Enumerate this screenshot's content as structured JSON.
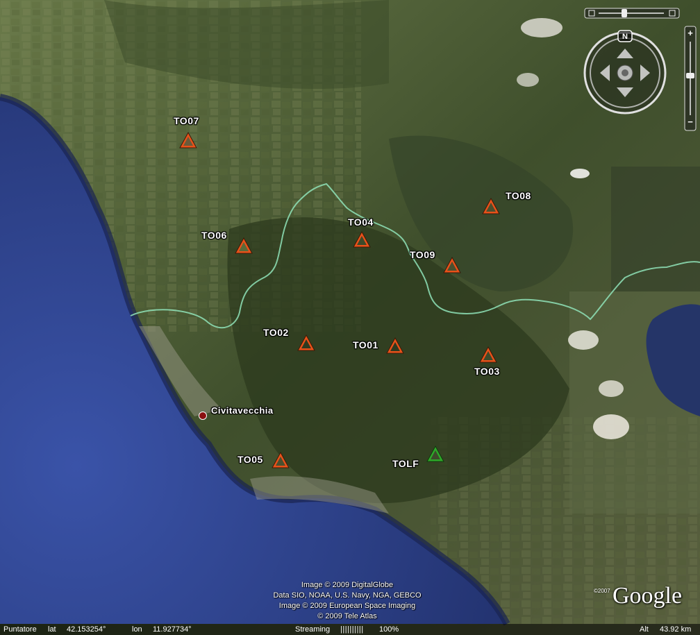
{
  "stations": [
    {
      "id": "TO07",
      "label": "TO07",
      "color": "#e8521a"
    },
    {
      "id": "TO06",
      "label": "TO06",
      "color": "#e8521a"
    },
    {
      "id": "TO04",
      "label": "TO04",
      "color": "#e8521a"
    },
    {
      "id": "TO08",
      "label": "TO08",
      "color": "#e8521a"
    },
    {
      "id": "TO09",
      "label": "TO09",
      "color": "#e8521a"
    },
    {
      "id": "TO02",
      "label": "TO02",
      "color": "#e8521a"
    },
    {
      "id": "TO01",
      "label": "TO01",
      "color": "#e8521a"
    },
    {
      "id": "TO03",
      "label": "TO03",
      "color": "#e8521a"
    },
    {
      "id": "TO05",
      "label": "TO05",
      "color": "#e8521a"
    },
    {
      "id": "TOLF",
      "label": "TOLF",
      "color": "#2fa82a"
    }
  ],
  "city": {
    "label": "Civitavecchia"
  },
  "credits": [
    "Image © 2009 DigitalGlobe",
    "Data SIO, NOAA, U.S. Navy, NGA, GEBCO",
    "Image © 2009 European Space Imaging",
    "© 2009 Tele Atlas"
  ],
  "status": {
    "pointer_label": "Puntatore",
    "lat_label": "lat",
    "lat_value": "42.153254°",
    "lon_label": "lon",
    "lon_value": "11.927734°",
    "streaming_label": "Streaming",
    "streaming_bar": "||||||||||",
    "streaming_percent": "100%",
    "alt_label": "Alt",
    "alt_value": "43.92 km"
  },
  "logo": {
    "text": "Google",
    "copyright": "©2007"
  },
  "nav": {
    "north": "N"
  },
  "colors": {
    "sea": "#2c3f86",
    "land": "#4a5a35",
    "border": "#8fe3b8"
  }
}
